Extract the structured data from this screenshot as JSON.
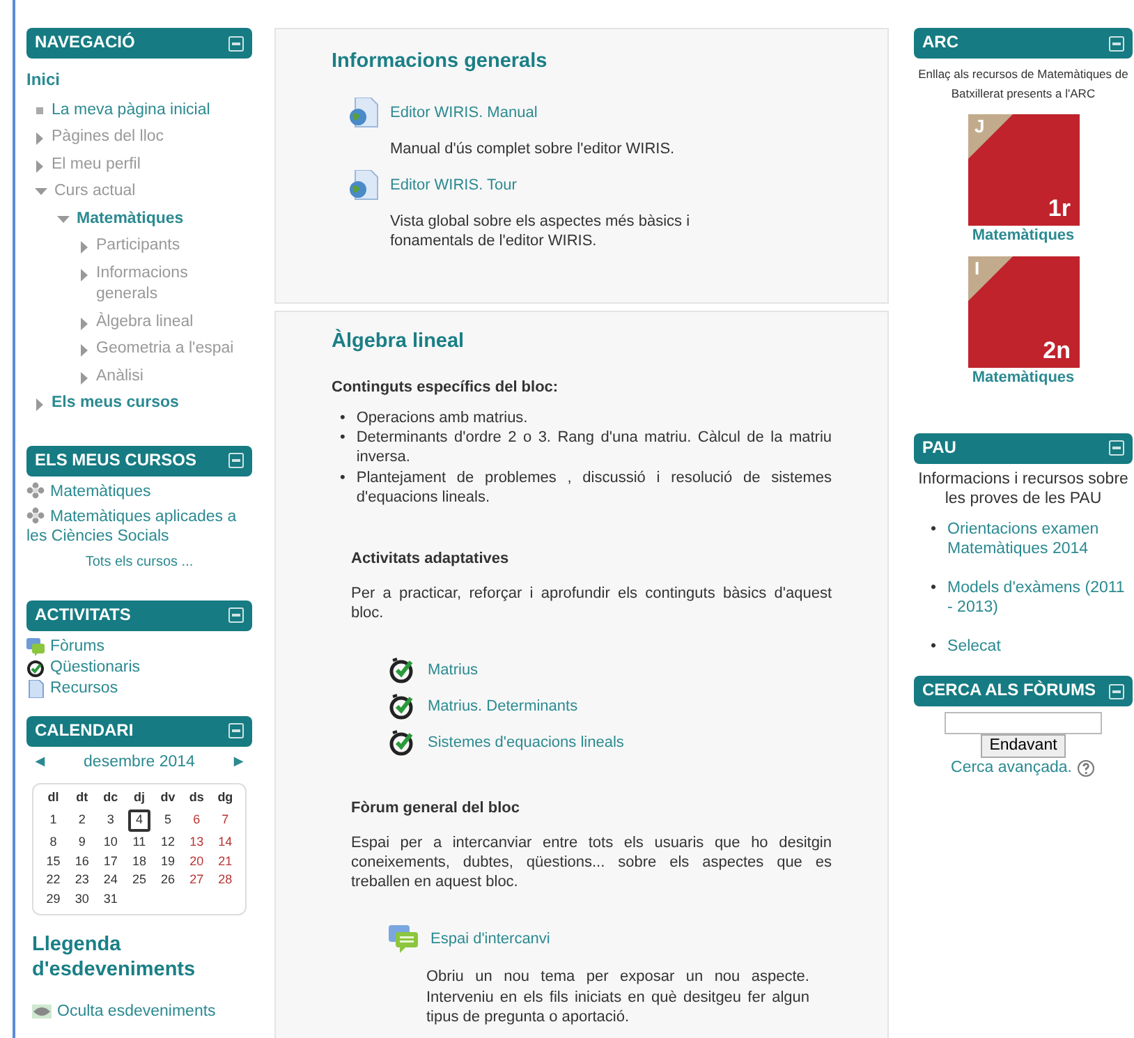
{
  "navigation": {
    "title": "NAVEGACIÓ",
    "home": "Inici",
    "items": [
      {
        "label": "La meva pàgina inicial",
        "kind": "home"
      },
      {
        "label": "Pàgines del lloc",
        "kind": "page",
        "expanded": false
      },
      {
        "label": "El meu perfil",
        "kind": "page",
        "expanded": false
      },
      {
        "label": "Curs actual",
        "kind": "page",
        "expanded": true,
        "children": [
          {
            "label": "Matemàtiques",
            "kind": "course",
            "expanded": true,
            "children": [
              {
                "label": "Participants",
                "kind": "page",
                "expanded": false
              },
              {
                "label": "Informacions generals",
                "kind": "page",
                "expanded": false
              },
              {
                "label": "Àlgebra lineal",
                "kind": "page",
                "expanded": false
              },
              {
                "label": "Geometria a l'espai",
                "kind": "page",
                "expanded": false
              },
              {
                "label": "Anàlisi",
                "kind": "page",
                "expanded": false
              }
            ]
          }
        ]
      },
      {
        "label": "Els meus cursos",
        "kind": "course",
        "expanded": false
      }
    ]
  },
  "my_courses": {
    "title": "ELS MEUS CURSOS",
    "courses": [
      "Matemàtiques",
      "Matemàtiques aplicades a les Ciències Socials"
    ],
    "all_courses": "Tots els cursos ..."
  },
  "activities": {
    "title": "ACTIVITATS",
    "items": [
      {
        "label": "Fòrums",
        "kind": "forum"
      },
      {
        "label": "Qüestionaris",
        "kind": "quiz"
      },
      {
        "label": "Recursos",
        "kind": "resource"
      }
    ]
  },
  "calendar": {
    "title": "CALENDARI",
    "prev": "◄",
    "month": "desembre 2014",
    "next": "►",
    "weekdays": [
      "dl",
      "dt",
      "dc",
      "dj",
      "dv",
      "ds",
      "dg"
    ],
    "weeks": [
      [
        {
          "d": "1",
          "today": false
        },
        {
          "d": "2",
          "today": false
        },
        {
          "d": "3",
          "today": false
        },
        {
          "d": "4",
          "today": true
        },
        {
          "d": "5",
          "today": false
        },
        {
          "d": "6",
          "today": false
        },
        {
          "d": "7",
          "today": false
        }
      ],
      [
        {
          "d": "8",
          "today": false
        },
        {
          "d": "9",
          "today": false
        },
        {
          "d": "10",
          "today": false
        },
        {
          "d": "11",
          "today": false
        },
        {
          "d": "12",
          "today": false
        },
        {
          "d": "13",
          "today": false
        },
        {
          "d": "14",
          "today": false
        }
      ],
      [
        {
          "d": "15",
          "today": false
        },
        {
          "d": "16",
          "today": false
        },
        {
          "d": "17",
          "today": false
        },
        {
          "d": "18",
          "today": false
        },
        {
          "d": "19",
          "today": false
        },
        {
          "d": "20",
          "today": false
        },
        {
          "d": "21",
          "today": false
        }
      ],
      [
        {
          "d": "22",
          "today": false
        },
        {
          "d": "23",
          "today": false
        },
        {
          "d": "24",
          "today": false
        },
        {
          "d": "25",
          "today": false
        },
        {
          "d": "26",
          "today": false
        },
        {
          "d": "27",
          "today": false
        },
        {
          "d": "28",
          "today": false
        }
      ],
      [
        {
          "d": "29",
          "today": false
        },
        {
          "d": "30",
          "today": false
        },
        {
          "d": "31",
          "today": false
        }
      ]
    ]
  },
  "legend": {
    "title": "Llegenda d'esdeveniments",
    "hide_link": "Oculta esdeveniments"
  },
  "sections": [
    {
      "title": "Informacions generals",
      "items": [
        {
          "kind": "resource",
          "label": "Editor WIRIS. Manual",
          "description": "Manual d'ús complet sobre l'editor WIRIS."
        },
        {
          "kind": "resource",
          "label": "Editor WIRIS. Tour",
          "description": "Vista global sobre els aspectes més bàsics i fonamentals de l'editor WIRIS."
        }
      ]
    },
    {
      "title": "Àlgebra lineal",
      "items": [
        {
          "kind": "heading",
          "text": "Continguts específics del bloc:"
        },
        {
          "kind": "bullets",
          "marker": "•",
          "items": [
            "Operacions amb matrius.",
            "Determinants d'ordre 2 o 3. Rang d'una matriu. Càlcul de la matriu inversa.",
            "Plantejament de problemes , discussió i resolució de sistemes d'equacions lineals."
          ]
        },
        {
          "kind": "subheading",
          "text": "Activitats adaptatives"
        },
        {
          "kind": "paragraph",
          "text": "Per a practicar, reforçar i aprofundir els continguts bàsics d'aquest bloc."
        },
        {
          "kind": "quiz",
          "label": "Matrius"
        },
        {
          "kind": "quiz",
          "label": "Matrius. Determinants"
        },
        {
          "kind": "quiz",
          "label": "Sistemes d'equacions lineals"
        },
        {
          "kind": "subheading",
          "text": "Fòrum general del bloc"
        },
        {
          "kind": "paragraph",
          "text": "Espai per a intercanviar entre tots els usuaris que ho desitgin coneixements, dubtes, qüestions... sobre els aspectes que es treballen en aquest bloc."
        },
        {
          "kind": "forum",
          "label": "Espai d'intercanvi",
          "description": "Obriu un nou tema per exposar un nou aspecte. Interveniu en els fils iniciats en què desitgeu fer algun tipus de pregunta o aportació."
        }
      ]
    }
  ],
  "arc": {
    "title": "ARC",
    "description": "Enllaç als recursos de Matemàtiques de Batxillerat presents a l'ARC",
    "tiles": [
      {
        "badge": "J",
        "level_label": "1r",
        "caption": "Matemàtiques"
      },
      {
        "badge": "I",
        "level_label": "2n",
        "caption": "Matemàtiques"
      }
    ]
  },
  "pau": {
    "title": "PAU",
    "description": "Informacions i recursos sobre les proves de les PAU",
    "marker": "•",
    "links": [
      "Orientacions examen Matemàtiques 2014",
      "Models d'exàmens (2011 - 2013)",
      "Selecat"
    ]
  },
  "forum_search": {
    "title": "CERCA ALS FÒRUMS",
    "button": "Endavant",
    "advanced": "Cerca avançada."
  }
}
